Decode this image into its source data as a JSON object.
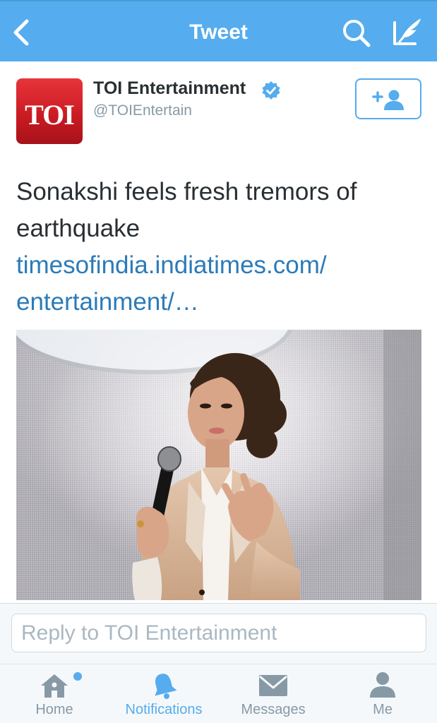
{
  "colors": {
    "brand": "#55acee",
    "link": "#2b7bb9",
    "verified": "#55acee",
    "muted": "#8899a6",
    "avatar_bg": "#d2232a"
  },
  "header": {
    "title": "Tweet",
    "back_icon": "chevron-left-icon",
    "search_icon": "search-icon",
    "compose_icon": "compose-icon"
  },
  "tweet": {
    "author": {
      "avatar_text": "TOI",
      "display_name": "TOI Entertainment",
      "handle": "@TOIEntertain",
      "verified_icon": "verified-badge-icon"
    },
    "follow_icon": "add-user-icon",
    "text": "Sonakshi feels fresh tremors of earthquake",
    "link_lines": [
      "timesofindia.indiatimes.com/",
      "entertainment/…"
    ]
  },
  "reply": {
    "placeholder": "Reply to TOI Entertainment"
  },
  "tabs": [
    {
      "label": "Home",
      "icon": "home-icon",
      "active": false,
      "badge": true
    },
    {
      "label": "Notifications",
      "icon": "bell-icon",
      "active": true,
      "badge": false
    },
    {
      "label": "Messages",
      "icon": "envelope-icon",
      "active": false,
      "badge": false
    },
    {
      "label": "Me",
      "icon": "person-icon",
      "active": false,
      "badge": false
    }
  ]
}
